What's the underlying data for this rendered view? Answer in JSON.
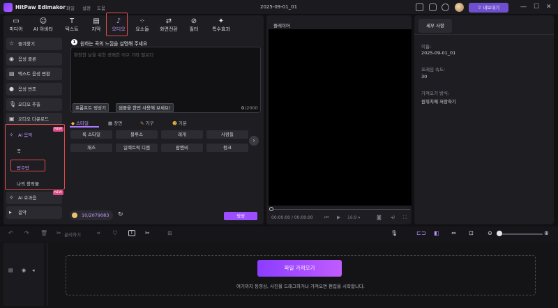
{
  "app": {
    "name": "HitPaw Edimakor",
    "menu": [
      "파일",
      "설정",
      "도움"
    ],
    "project": "2025-09-01_01",
    "export_label": "내보내기"
  },
  "tabs": [
    {
      "label": "미디어",
      "icon": "folder-icon"
    },
    {
      "label": "AI 아바타",
      "icon": "avatar-icon"
    },
    {
      "label": "텍스트",
      "icon": "text-icon"
    },
    {
      "label": "자막",
      "icon": "subtitle-icon"
    },
    {
      "label": "오디오",
      "icon": "music-icon",
      "active": true
    },
    {
      "label": "요소들",
      "icon": "elements-icon"
    },
    {
      "label": "화면전환",
      "icon": "transition-icon"
    },
    {
      "label": "필터",
      "icon": "filter-icon"
    },
    {
      "label": "특수효과",
      "icon": "effects-icon"
    }
  ],
  "sidebar": {
    "items": [
      {
        "label": "즐겨찾기",
        "icon": "star-icon"
      },
      {
        "label": "음성 클론",
        "icon": "voice-clone-icon"
      },
      {
        "label": "텍스트 음성 변환",
        "icon": "tts-icon"
      },
      {
        "label": "음성 변조",
        "icon": "voice-changer-icon"
      },
      {
        "label": "오디오 추출",
        "icon": "mic-icon"
      },
      {
        "label": "오디오 다운로드",
        "icon": "download-icon"
      }
    ],
    "ai_music": {
      "label": "AI 음악",
      "badge": "NEW",
      "subs": [
        "곡",
        "반주만",
        "나의 창작물"
      ]
    },
    "ai_effects": {
      "label": "AI 효과음",
      "badge": "NEW"
    },
    "music": {
      "label": "음악"
    }
  },
  "prompt": {
    "step": "1",
    "title": "원하는 곡의 느낌을 설명해 주세요",
    "placeholder": "화창한 날을 위한 경쾌한 어쿠 기타 멜로디",
    "btn_generator": "프롬프트 생성기",
    "btn_sample": "샘플을 한번 사용해 보세요!",
    "count": "0",
    "max": "/2000"
  },
  "style_tabs": [
    {
      "label": "스타일",
      "icon": "style-icon",
      "active": true
    },
    {
      "label": "장면",
      "icon": "scene-icon"
    },
    {
      "label": "기구",
      "icon": "guitar-icon"
    },
    {
      "label": "기분",
      "icon": "mood-icon"
    }
  ],
  "styles": [
    "록 스타일",
    "블루스",
    "레게",
    "사랑들",
    "재즈",
    "일렉트릭 디엠",
    "팝멘비",
    "펑크"
  ],
  "credits": {
    "value": "10/2079083"
  },
  "generate_label": "생성",
  "player": {
    "title": "플레이어",
    "time": "00:00:00 / 00:00:00",
    "ratio": "16:9"
  },
  "properties": {
    "tab": "세부 사항",
    "name_label": "이름:",
    "name": "2025-09-01_01",
    "fps_label": "프레임 속도:",
    "fps": "30",
    "import_label": "가져오기 방식:",
    "import_value": "원위치에 저장하기"
  },
  "timeline": {
    "split_label": "분리하기",
    "import_label": "파일 가져오기",
    "hint": "여기까지 동영상, 사진을 드래그하거나 가져오면 편집을 시작합니다."
  },
  "colors": {
    "accent": "#8b3dff",
    "highlight": "#e24a4a",
    "badge": "#e24a8a"
  }
}
